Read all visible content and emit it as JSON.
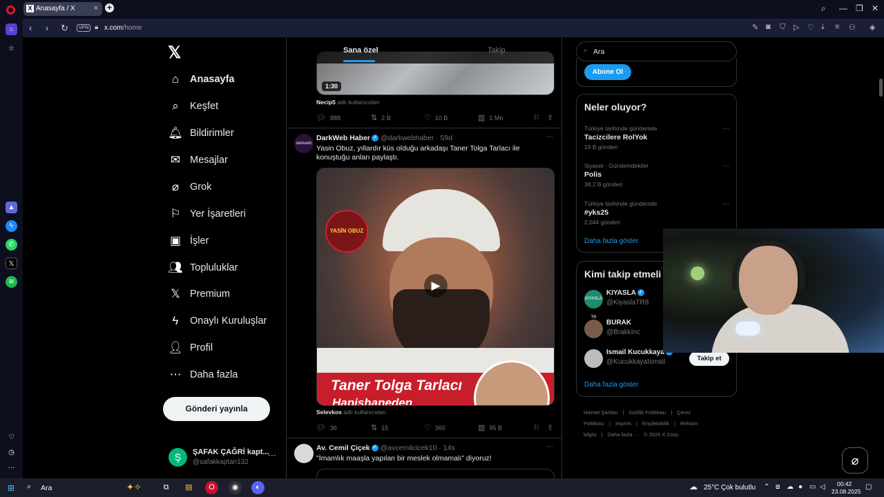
{
  "browser": {
    "tab_title": "Anasayfa / X",
    "tab_favicon": "X",
    "new_tab": "+",
    "vpn": "VPN",
    "url_host": "x.com",
    "url_path": "/home"
  },
  "sidebar_nav": {
    "items": [
      {
        "label": "Anasayfa",
        "icon": "home-icon",
        "glyph": "⌂"
      },
      {
        "label": "Keşfet",
        "icon": "search-icon",
        "glyph": "⌕"
      },
      {
        "label": "Bildirimler",
        "icon": "bell-icon",
        "glyph": "🔔︎"
      },
      {
        "label": "Mesajlar",
        "icon": "mail-icon",
        "glyph": "✉"
      },
      {
        "label": "Grok",
        "icon": "grok-icon",
        "glyph": "⌀"
      },
      {
        "label": "Yer İşaretleri",
        "icon": "bookmark-icon",
        "glyph": "⚐"
      },
      {
        "label": "İşler",
        "icon": "briefcase-icon",
        "glyph": "▣"
      },
      {
        "label": "Topluluklar",
        "icon": "communities-icon",
        "glyph": "👥︎"
      },
      {
        "label": "Premium",
        "icon": "x-premium-icon",
        "glyph": "𝕏"
      },
      {
        "label": "Onaylı Kuruluşlar",
        "icon": "lightning-icon",
        "glyph": "ϟ"
      },
      {
        "label": "Profil",
        "icon": "person-icon",
        "glyph": "👤︎"
      },
      {
        "label": "Daha fazla",
        "icon": "more-circle-icon",
        "glyph": "⋯"
      }
    ],
    "post_button": "Gönderi yayınla",
    "profile": {
      "avatar_letter": "Ş",
      "name": "ŞAFAK ÇAĞRİ kapt...",
      "handle": "@safakkaptan132"
    }
  },
  "timeline": {
    "tabs": [
      "Sana özel",
      "Takip"
    ],
    "post1": {
      "duration": "1:30",
      "attribution_user": "Necip5",
      "attribution_suffix": "adlı kullanıcıdan",
      "replies": "888",
      "reposts": "2 B",
      "likes": "10 B",
      "views": "1 Mn"
    },
    "post2": {
      "avatar_text": "darkweb",
      "name": "DarkWeb Haber",
      "handle": "@darkwebhaber · 59d",
      "text": "Yasin Obuz, yıllardır küs olduğu arkadaşı Taner Tolga Tarlacı ile konuştuğu anları paylaştı.",
      "video_logo": "YASİN OBUZ",
      "video_banner": "Taner Tolga Tarlacı",
      "video_banner_sub": "Hapishaneden",
      "attribution_user": "Selevkos",
      "attribution_suffix": "adlı kullanıcıdan",
      "replies": "36",
      "reposts": "15",
      "likes": "360",
      "views": "95 B"
    },
    "post3": {
      "name": "Av. Cemil Çiçek",
      "handle": "@avcemilcicek10 · 14s",
      "text": "\"İmamlık maaşla yapılan bir meslek olmamalı\" diyoruz!"
    }
  },
  "right_column": {
    "search_placeholder": "Ara",
    "subscribe_button": "Abone Ol",
    "trends": {
      "title": "Neler oluyor?",
      "items": [
        {
          "context": "Türkiye tarihinde gündemde",
          "name": "Tacizcilere RolYok",
          "count": "19 B gönderi"
        },
        {
          "context": "Siyaset · Gündemdekiler",
          "name": "Polis",
          "count": "38,2 B gönderi"
        },
        {
          "context": "Türkiye tarihinde gündemde",
          "name": "#yks25",
          "count": "2.044 gönderi"
        }
      ],
      "show_more": "Daha fazla göster"
    },
    "who_to_follow": {
      "title": "Kimi takip etmeli",
      "items": [
        {
          "name": "KIYASLA",
          "handle": "@KiyaslaTR8",
          "verified": true,
          "avatar_text": "KIYASLA TR",
          "avatar_color": "#1f8a70"
        },
        {
          "name": "BURAK",
          "handle": "@BrakkInc",
          "verified": false,
          "avatar_text": "",
          "avatar_color": "#7a5a48"
        },
        {
          "name": "Ismail Kucukkaya",
          "handle": "@KucukkayaIsmail",
          "verified": true,
          "avatar_text": "",
          "avatar_color": "#bdbdbd"
        }
      ],
      "follow_button": "Takip et",
      "show_more": "Daha fazla göster"
    },
    "footer": [
      "Hizmet Şartları",
      "|",
      "Gizlilik Politikası",
      "|",
      "Çerez Politikası",
      "|",
      "Imprint",
      "|",
      "Erişilebilirlik",
      "|",
      "Reklam bilgisi",
      "|",
      "Daha fazla ···",
      "© 2025 X Corp."
    ]
  },
  "taskbar": {
    "search_text": "Ara",
    "weather_temp": "25°C",
    "weather_desc": "Çok bulutlu",
    "time": "00:42",
    "date": "23.08.2025"
  },
  "colors": {
    "accent": "#1d9bf0",
    "background": "#000000",
    "border": "#2f3336",
    "text_secondary": "#71767b"
  }
}
